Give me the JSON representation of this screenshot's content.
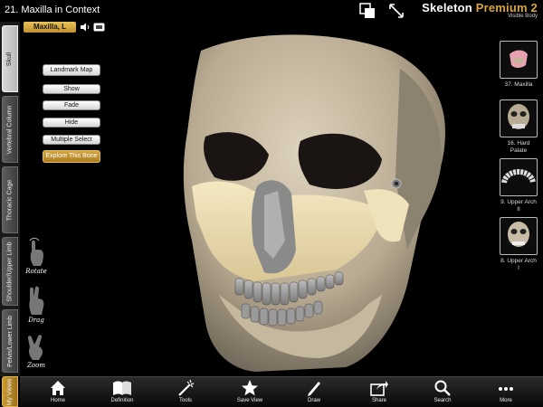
{
  "header": {
    "title": "21. Maxilla in Context",
    "brand_main": "Skeleton",
    "brand_premium": "Premium 2",
    "brand_sub": "Visible Body"
  },
  "tabs": [
    {
      "label": "Skull",
      "active": true
    },
    {
      "label": "Vertebral Column",
      "active": false
    },
    {
      "label": "Thoracic Cage",
      "active": false
    },
    {
      "label": "Shoulder/Upper Limb",
      "active": false
    },
    {
      "label": "Pelvis/Lower Limb",
      "active": false
    },
    {
      "label": "My Views",
      "active": false
    }
  ],
  "bone_label": "Maxilla, L",
  "buttons": {
    "landmark_map": "Landmark Map",
    "show": "Show",
    "fade": "Fade",
    "hide": "Hide",
    "multiple_select": "Multiple Select",
    "explore": "Explore This Bone"
  },
  "gestures": {
    "rotate": "Rotate",
    "drag": "Drag",
    "zoom": "Zoom"
  },
  "thumbnails": [
    {
      "caption": "37. Maxilla"
    },
    {
      "caption": "16. Hard Palate"
    },
    {
      "caption": "9. Upper Arch II"
    },
    {
      "caption": "8. Upper Arch I"
    }
  ],
  "toolbar": {
    "home": "Home",
    "definition": "Definition",
    "tools": "Tools",
    "save_view": "Save View",
    "draw": "Draw",
    "share": "Share",
    "search": "Search",
    "more": "More"
  },
  "colors": {
    "gold": "#c99a2e",
    "bone": "#ece0b4",
    "skull": "#cdbfa6"
  }
}
